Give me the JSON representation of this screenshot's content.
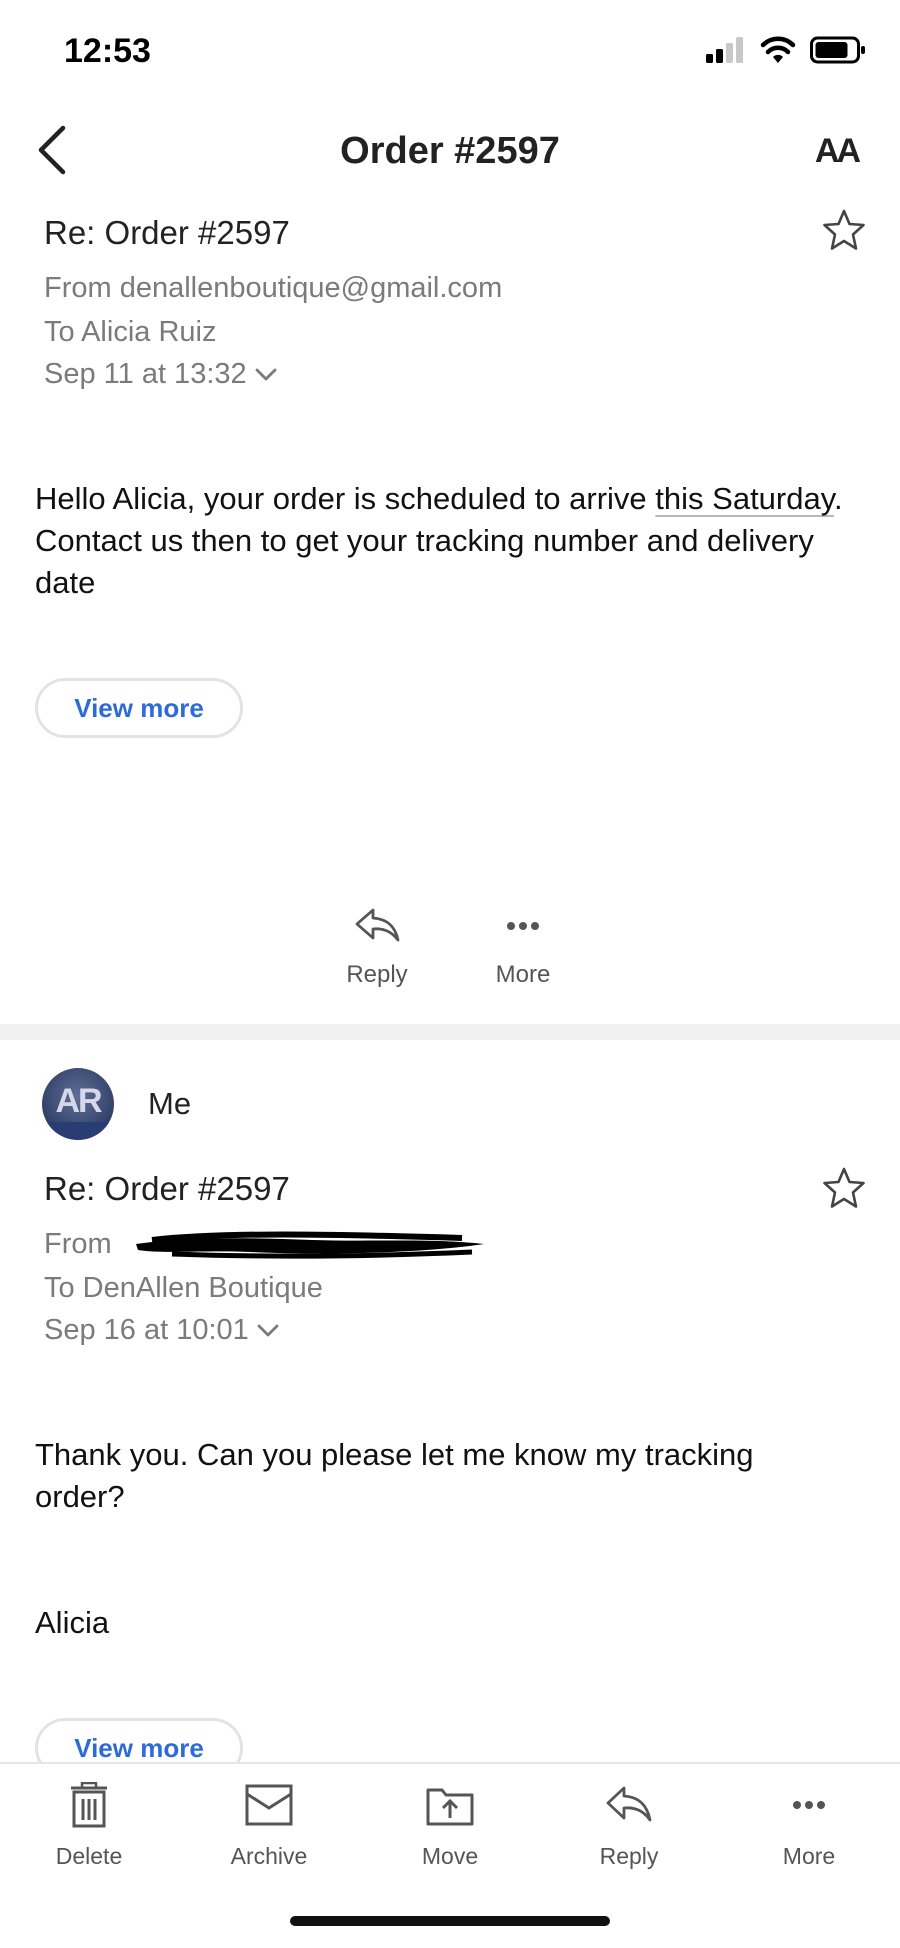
{
  "status_bar": {
    "time": "12:53"
  },
  "nav": {
    "title": "Order #2597",
    "text_size_label": "AA"
  },
  "messages": [
    {
      "subject": "Re: Order #2597",
      "from": "From denallenboutique@gmail.com",
      "to": "To Alicia Ruiz",
      "date": "Sep 11 at 13:32",
      "body": {
        "part1": "Hello Alicia, your order is scheduled to arrive ",
        "link": "this Saturday",
        "part2": ". Contact us then to get your tracking number and delivery date"
      },
      "view_more": "View more",
      "actions": {
        "reply": "Reply",
        "more": "More"
      }
    },
    {
      "sender": "Me",
      "avatar_initials": "AR",
      "subject": "Re: Order #2597",
      "from_prefix": "From",
      "to": "To DenAllen Boutique",
      "date": "Sep 16 at 10:01",
      "body_line1": "Thank you. Can you please let me know my tracking order?",
      "signature": "Alicia",
      "view_more": "View more"
    }
  ],
  "toolbar": {
    "delete": "Delete",
    "archive": "Archive",
    "move": "Move",
    "reply": "Reply",
    "more": "More"
  },
  "colors": {
    "link_blue": "#2d6bd8",
    "meta_gray": "#7a7a7f"
  }
}
